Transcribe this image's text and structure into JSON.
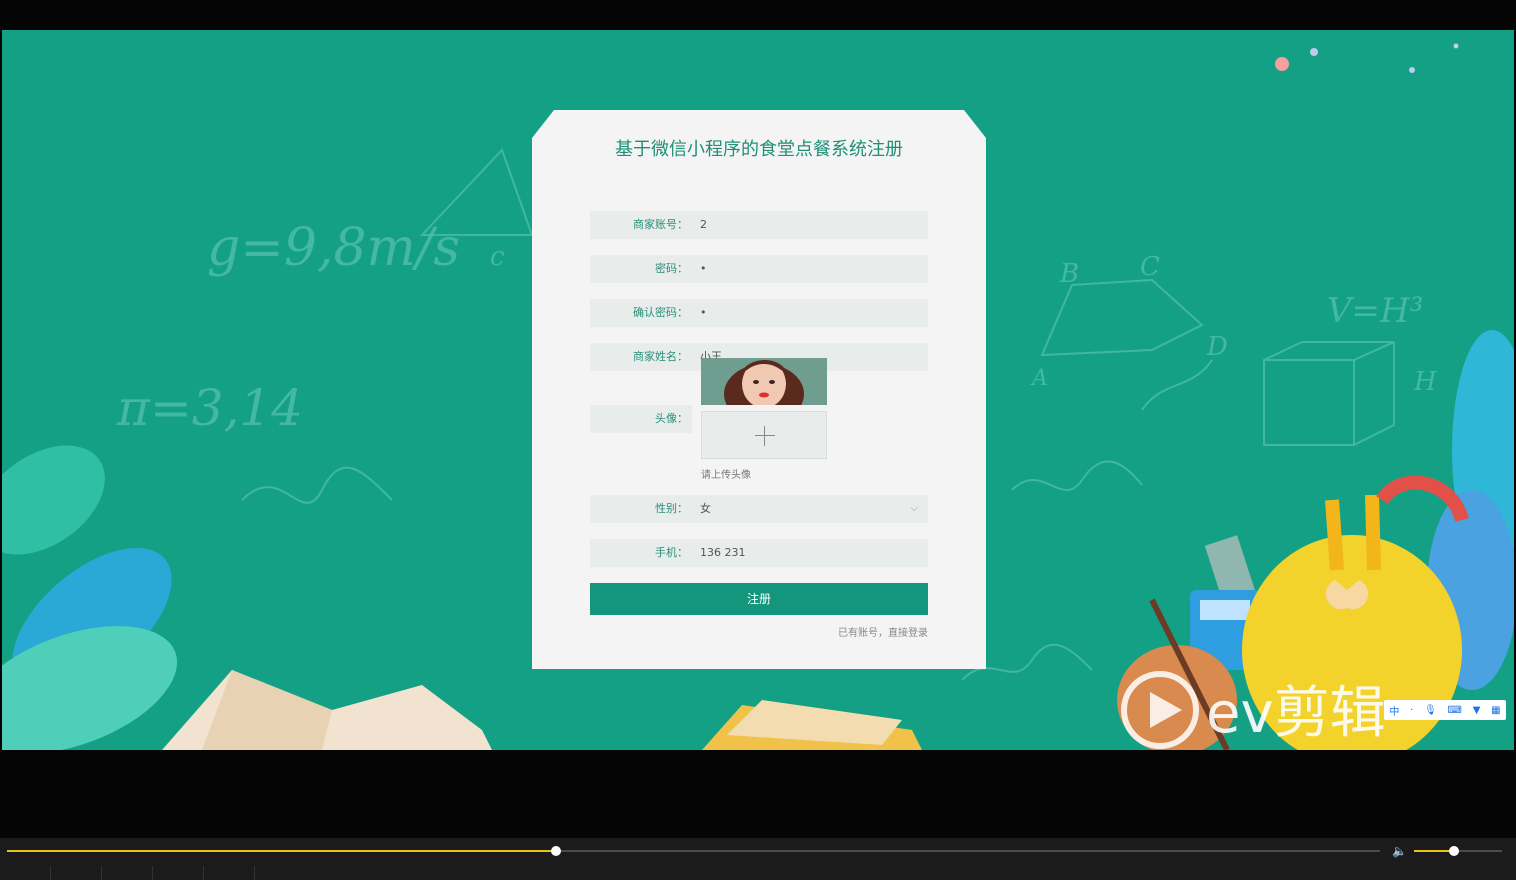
{
  "form": {
    "title": "基于微信小程序的食堂点餐系统注册",
    "fields": [
      {
        "label": "商家账号：",
        "value": "2"
      },
      {
        "label": "密码：",
        "value": "•"
      },
      {
        "label": "确认密码：",
        "value": "•"
      },
      {
        "label": "商家姓名：",
        "value": "小王"
      }
    ],
    "avatar_label": "头像：",
    "upload_hint": "请上传头像",
    "gender_label": "性别：",
    "gender_value": "女",
    "phone_label": "手机：",
    "phone_value": "136 231",
    "submit_label": "注册",
    "login_link": "已有账号，直接登录"
  },
  "background": {
    "chalk_formulas": [
      "g=9,8m/s",
      "π=3,14",
      "V=H³",
      "B",
      "C",
      "D",
      "A",
      "H",
      "c"
    ]
  },
  "watermark": {
    "text": "ev剪辑"
  },
  "ime_toolbar": {
    "lang": "中"
  },
  "player": {
    "progress": 0.4,
    "volume": 0.45
  },
  "colors": {
    "accent": "#14967c",
    "background": "#14a085",
    "progress": "#e8c21a"
  }
}
